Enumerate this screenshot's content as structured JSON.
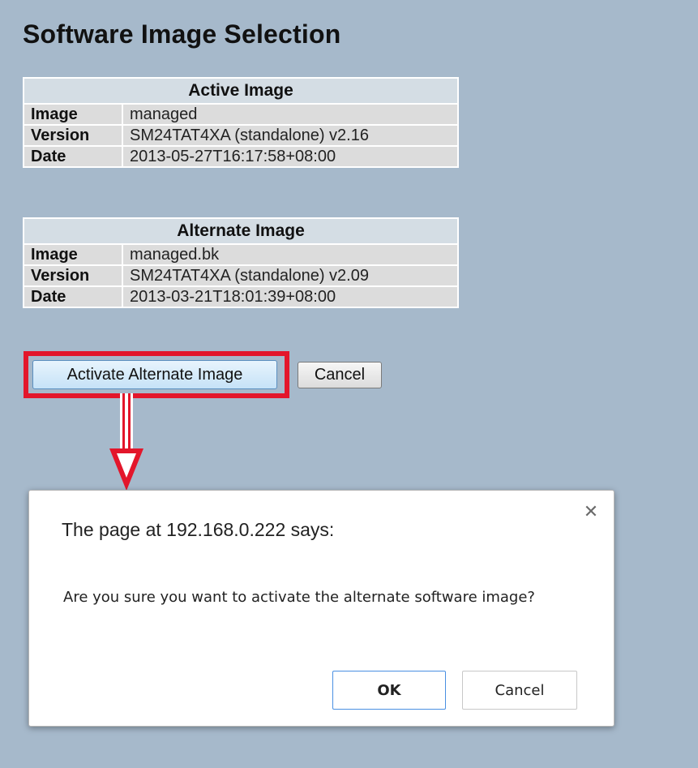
{
  "page": {
    "title": "Software Image Selection"
  },
  "active_image": {
    "header": "Active Image",
    "rows": [
      {
        "param": "Image",
        "value": "managed"
      },
      {
        "param": "Version",
        "value": "SM24TAT4XA (standalone) v2.16"
      },
      {
        "param": "Date",
        "value": "2013-05-27T16:17:58+08:00"
      }
    ]
  },
  "alternate_image": {
    "header": "Alternate Image",
    "rows": [
      {
        "param": "Image",
        "value": "managed.bk"
      },
      {
        "param": "Version",
        "value": "SM24TAT4XA (standalone) v2.09"
      },
      {
        "param": "Date",
        "value": "2013-03-21T18:01:39+08:00"
      }
    ]
  },
  "buttons": {
    "activate_label": "Activate Alternate Image",
    "cancel_label": "Cancel"
  },
  "annotation": {
    "highlight_color": "#e3162b"
  },
  "dialog": {
    "title": "The page at 192.168.0.222 says:",
    "message": "Are you sure you want to activate the alternate software image?",
    "close_icon": "close-icon",
    "ok_label": "OK",
    "cancel_label": "Cancel"
  },
  "colors": {
    "page_background": "#a6b9cb",
    "table_header": "#d4dde4",
    "table_cell": "#dcdcdc",
    "ok_border": "#4a90e2"
  }
}
